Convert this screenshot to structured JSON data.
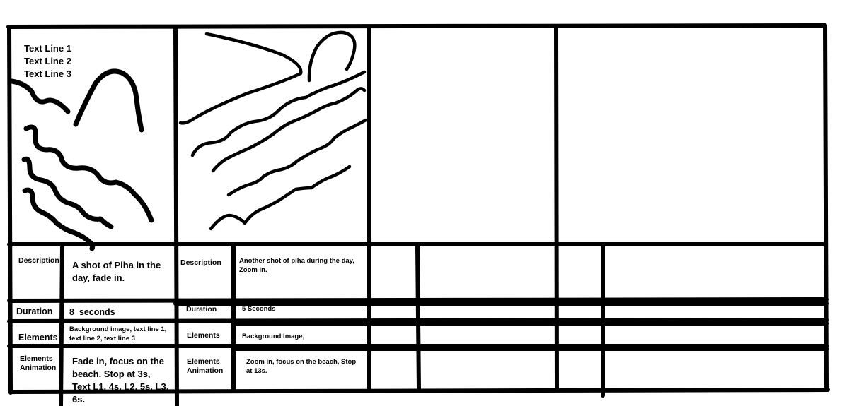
{
  "panels": [
    {
      "overlay_text": [
        "Text Line 1",
        "Text Line 2",
        "Text Line 3"
      ],
      "description_label": "Description",
      "description": "A shot of Piha in the day, fade in.",
      "duration_label": "Duration",
      "duration": "8  seconds",
      "elements_label": "Elements",
      "elements": "Background image, text line 1, text line 2, text line 3",
      "animation_label": "Elements\nAnimation",
      "animation": "Fade in, focus on the beach. Stop at 3s, Text L1, 4s, L2, 5s, L3, 6s."
    },
    {
      "description_label": "Description",
      "description": "Another shot of piha during the day, Zoom in.",
      "duration_label": "Duration",
      "duration": "5 Seconds",
      "elements_label": "Elements",
      "elements": "Background Image,",
      "animation_label": "Elements\nAnimation",
      "animation": "Zoom in, focus on the beach, Stop at 13s."
    }
  ],
  "colors": {
    "ink": "#000000",
    "paper": "#ffffff"
  }
}
